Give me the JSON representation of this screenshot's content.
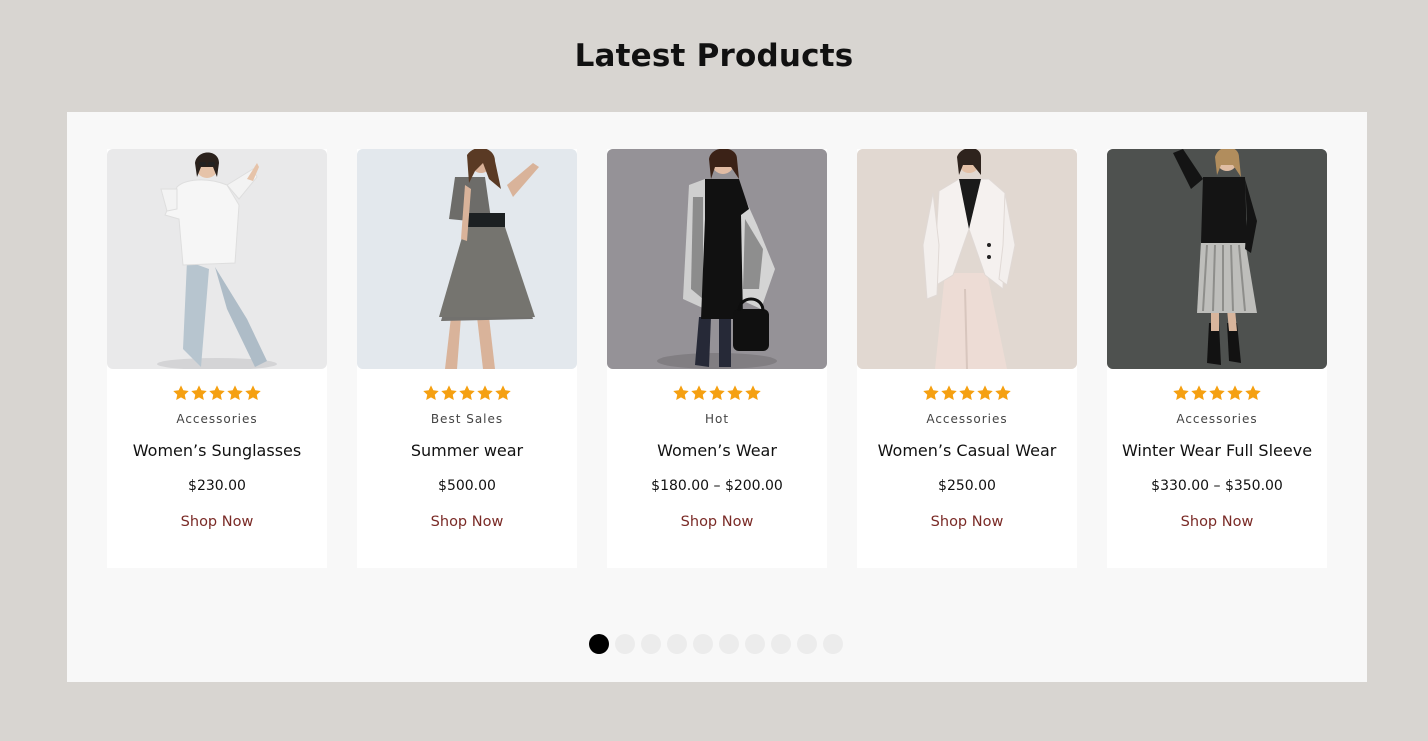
{
  "section": {
    "title": "Latest Products"
  },
  "colors": {
    "accent": "#7a2a26",
    "star": "#f5a011",
    "page_bg": "#d8d5d1",
    "panel_bg": "#f8f8f8"
  },
  "products": [
    {
      "category": "Accessories",
      "title": "Women’s Sunglasses",
      "price": "$230.00",
      "cta": "Shop Now",
      "rating": 5,
      "image_icon": "model-white-sweater-image"
    },
    {
      "category": "Best Sales",
      "title": "Summer wear",
      "price": "$500.00",
      "cta": "Shop Now",
      "rating": 5,
      "image_icon": "model-grey-dress-image"
    },
    {
      "category": "Hot",
      "title": "Women’s Wear",
      "price": "$180.00 – $200.00",
      "cta": "Shop Now",
      "rating": 5,
      "image_icon": "model-black-dress-image"
    },
    {
      "category": "Accessories",
      "title": "Women’s Casual Wear",
      "price": "$250.00",
      "cta": "Shop Now",
      "rating": 5,
      "image_icon": "model-white-blazer-image"
    },
    {
      "category": "Accessories",
      "title": "Winter Wear Full Sleeve",
      "price": "$330.00 – $350.00",
      "cta": "Shop Now",
      "rating": 5,
      "image_icon": "model-pleated-skirt-image"
    }
  ],
  "pagination": {
    "total": 10,
    "active_index": 0
  }
}
